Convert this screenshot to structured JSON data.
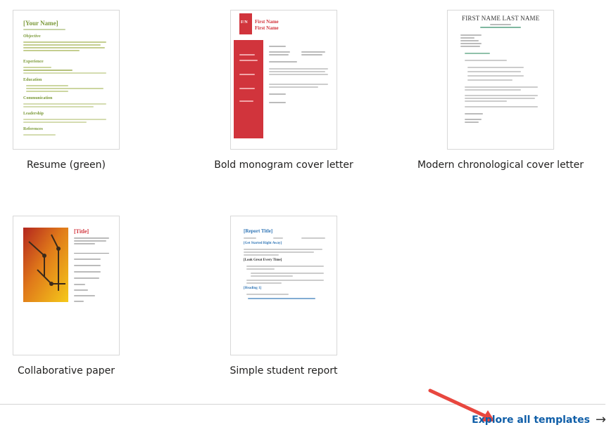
{
  "templates": [
    {
      "label": "Resume (green)",
      "preview": {
        "name": "[Your Name]",
        "sections": [
          "Objective",
          "Experience",
          "Education",
          "Communication",
          "Leadership",
          "References"
        ]
      }
    },
    {
      "label": "Bold monogram cover letter",
      "preview": {
        "monogram": "F/N",
        "name_line1": "First Name",
        "name_line2": "First Name"
      }
    },
    {
      "label": "Modern chronological cover letter",
      "preview": {
        "heading": "FIRST NAME LAST NAME"
      }
    },
    {
      "label": "Collaborative paper",
      "preview": {
        "title": "[Title]"
      }
    },
    {
      "label": "Simple student report",
      "preview": {
        "title": "[Report Title]",
        "subhead1": "[Get Started Right Away]",
        "subhead2": "[Look Great Every Time]",
        "subhead3": "[Heading 1]"
      }
    }
  ],
  "explore": {
    "label": "Explore all templates",
    "icon": "arrow-right-icon"
  },
  "colors": {
    "accent_link": "#0f5ea8",
    "resume_green": "#7c9a3a",
    "monogram_red": "#d1343c",
    "report_blue": "#2e74b5",
    "annotation_red": "#e8473f"
  }
}
